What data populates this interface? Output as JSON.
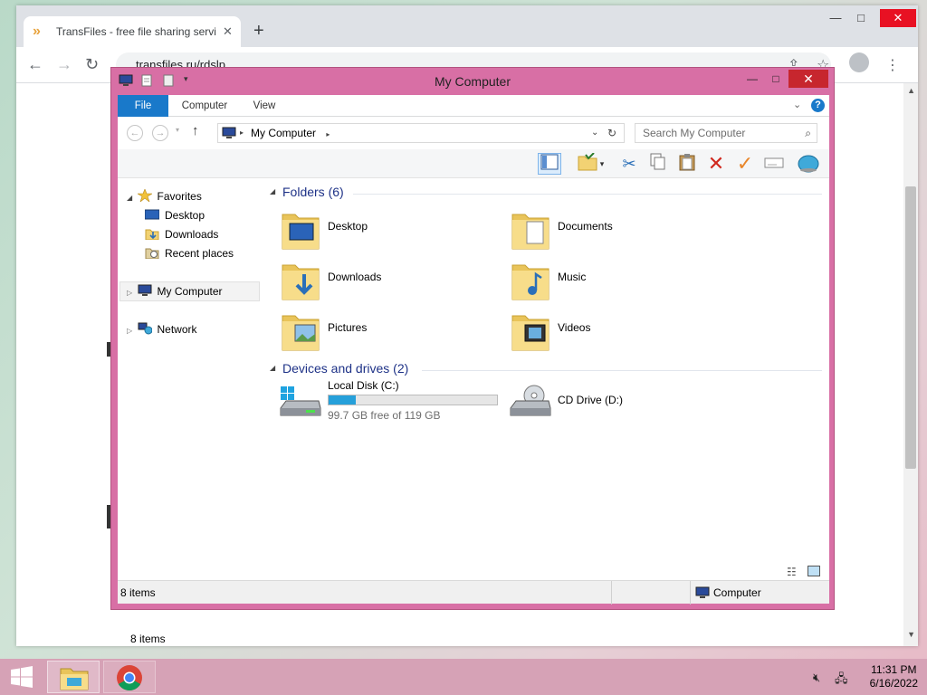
{
  "browser": {
    "tab_title": "TransFiles - free file sharing servi",
    "new_tab_label": "+",
    "url": "transfiles.ru/rdslp"
  },
  "explorer": {
    "window_title": "My Computer",
    "ribbon_tabs": [
      "File",
      "Computer",
      "View"
    ],
    "address": "My Computer",
    "search_placeholder": "Search My Computer",
    "nav": {
      "favorites": "Favorites",
      "desktop": "Desktop",
      "downloads": "Downloads",
      "recent": "Recent places",
      "my_computer": "My Computer",
      "network": "Network"
    },
    "folders_header": "Folders (6)",
    "folders": [
      "Desktop",
      "Documents",
      "Downloads",
      "Music",
      "Pictures",
      "Videos"
    ],
    "devices_header": "Devices and drives (2)",
    "drives": [
      {
        "name": "Local Disk (C:)",
        "free": "99.7 GB free of 119 GB",
        "used_fraction": 0.162
      },
      {
        "name": "CD Drive (D:)"
      }
    ],
    "items_count": "8 items",
    "status_left": "8 items",
    "status_right": "Computer"
  },
  "taskbar": {
    "time": "11:31 PM",
    "date": "6/16/2022"
  },
  "colors": {
    "window_frame": "#d86fa5",
    "file_tab": "#1979ca",
    "group_header": "#1e3287",
    "drive_fill": "#26a0da",
    "taskbar": "#d6a2b6"
  }
}
